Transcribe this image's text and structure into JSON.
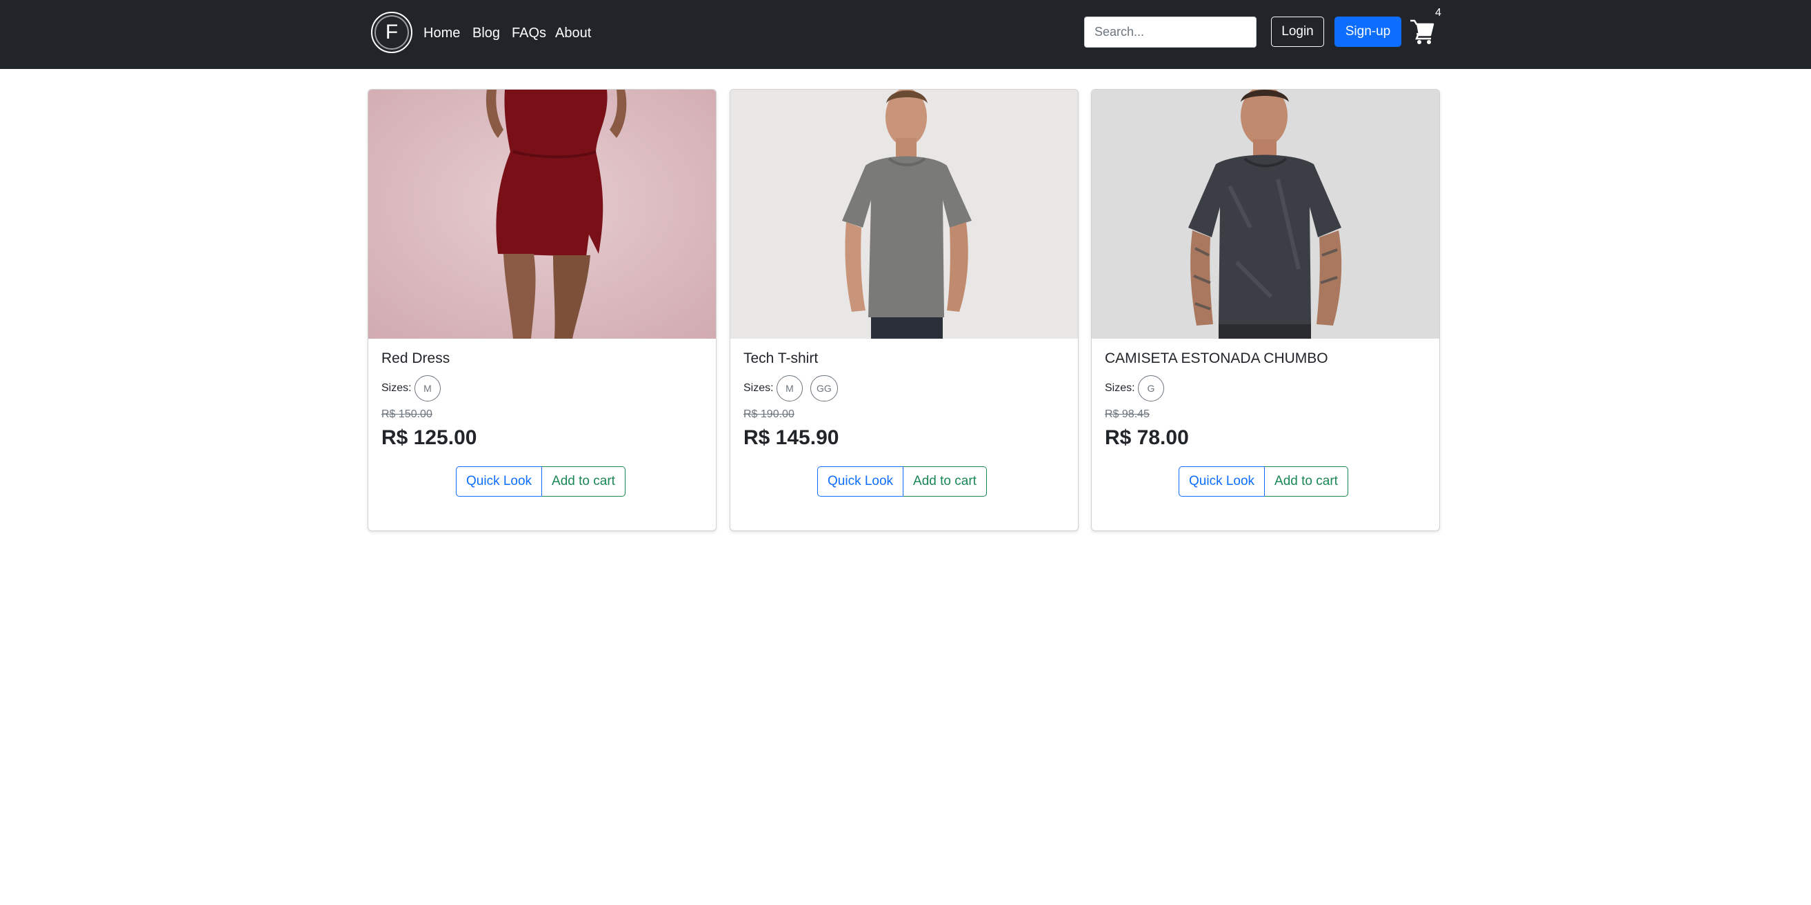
{
  "brand": {
    "logo_letter": "F"
  },
  "nav": {
    "links": [
      "Home",
      "Blog",
      "FAQs",
      "About"
    ],
    "search_placeholder": "Search...",
    "login_label": "Login",
    "signup_label": "Sign-up",
    "cart_icon": "cart-icon",
    "cart_count": "4"
  },
  "colors": {
    "navbar_bg": "#212529",
    "primary": "#0d6efd",
    "success": "#198754",
    "muted": "#6c757d"
  },
  "products": [
    {
      "title": "Red Dress",
      "sizes_label": "Sizes:",
      "sizes": [
        "M"
      ],
      "old_price": "R$ 150.00",
      "price": "R$ 125.00",
      "quick_look_label": "Quick Look",
      "add_to_cart_label": "Add to cart"
    },
    {
      "title": "Tech T-shirt",
      "sizes_label": "Sizes:",
      "sizes": [
        "M",
        "GG"
      ],
      "old_price": "R$ 190.00",
      "price": "R$ 145.90",
      "quick_look_label": "Quick Look",
      "add_to_cart_label": "Add to cart"
    },
    {
      "title": "CAMISETA ESTONADA CHUMBO",
      "sizes_label": "Sizes:",
      "sizes": [
        "G"
      ],
      "old_price": "R$ 98.45",
      "price": "R$ 78.00",
      "quick_look_label": "Quick Look",
      "add_to_cart_label": "Add to cart"
    }
  ]
}
